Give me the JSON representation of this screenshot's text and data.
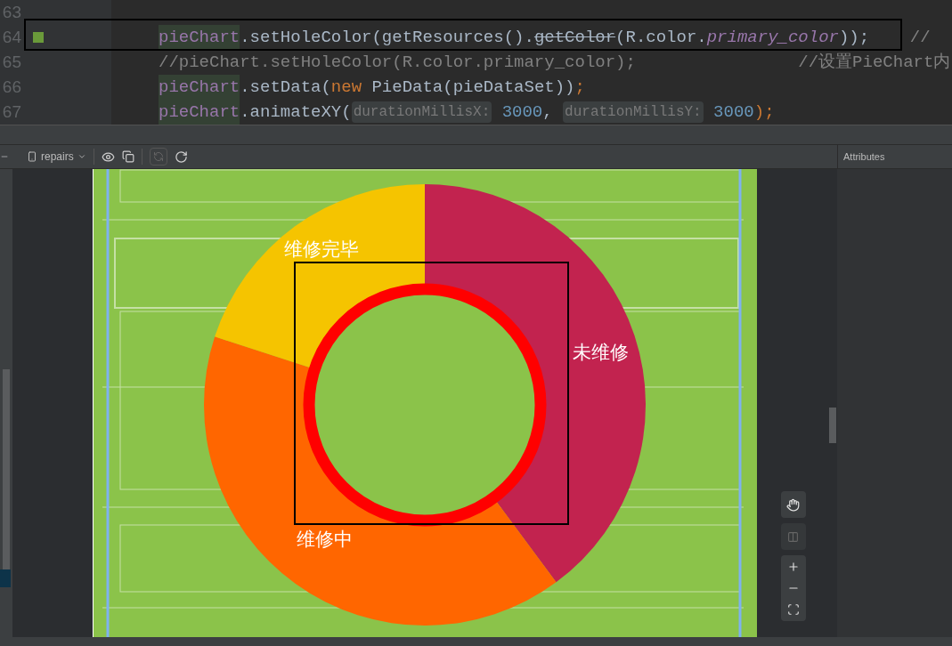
{
  "editor": {
    "lines": [
      {
        "number": "63",
        "marked": false
      },
      {
        "number": "64",
        "marked": true,
        "tokens": [
          {
            "text": "pieChart",
            "kind": "usage"
          },
          {
            "text": ".setHoleColor(getResources().",
            "kind": "plain"
          },
          {
            "text": "getColor",
            "kind": "deprecated"
          },
          {
            "text": "(R.color.",
            "kind": "plain"
          },
          {
            "text": "primary_color",
            "kind": "italic-field"
          },
          {
            "text": "));",
            "kind": "plain"
          },
          {
            "text": "    //",
            "kind": "comment"
          }
        ]
      },
      {
        "number": "65",
        "marked": false,
        "tokens": [
          {
            "text": "//pieChart.setHoleColor(R.color.primary_color);                //设置PieChart内",
            "kind": "comment"
          }
        ]
      },
      {
        "number": "66",
        "marked": false,
        "tokens": [
          {
            "text": "pieChart",
            "kind": "usage"
          },
          {
            "text": ".setData(",
            "kind": "plain"
          },
          {
            "text": "new ",
            "kind": "keyword"
          },
          {
            "text": "PieData(pieDataSet))",
            "kind": "plain"
          },
          {
            "text": ";",
            "kind": "keyword"
          }
        ]
      },
      {
        "number": "67",
        "marked": false,
        "tokens": [
          {
            "text": "pieChart",
            "kind": "usage"
          },
          {
            "text": ".animateXY(",
            "kind": "plain"
          },
          {
            "text": "durationMillisX:",
            "kind": "hint"
          },
          {
            "text": " 3000",
            "kind": "number"
          },
          {
            "text": ", ",
            "kind": "plain"
          },
          {
            "text": "durationMillisY:",
            "kind": "hint"
          },
          {
            "text": " 3000",
            "kind": "number"
          },
          {
            "text": ");",
            "kind": "keyword"
          }
        ]
      }
    ]
  },
  "toolbar": {
    "device": "repairs"
  },
  "attributes": {
    "title": "Attributes"
  },
  "preview": {
    "labels": [
      {
        "text": "维修完毕"
      },
      {
        "text": "未维修"
      },
      {
        "text": "维修中"
      }
    ]
  }
}
